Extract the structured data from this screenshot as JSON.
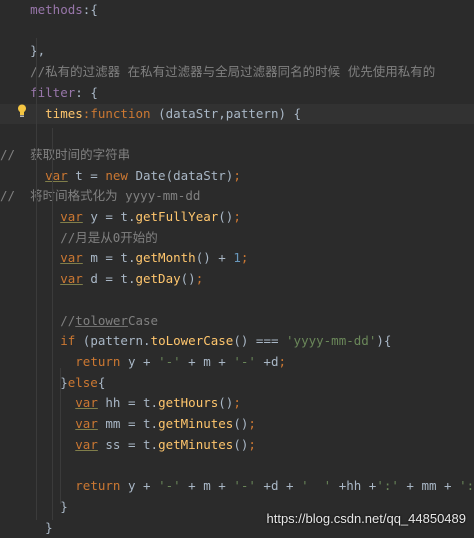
{
  "colors": {
    "background": "#2b2b2b",
    "keyword": "#cc7832",
    "property": "#9876aa",
    "function": "#ffc66d",
    "string": "#6a8759",
    "number": "#6897bb",
    "comment": "#808080",
    "text": "#a9b7c6"
  },
  "lines": [
    [
      {
        "t": "    "
      },
      {
        "t": "methods",
        "c": "prop"
      },
      {
        "t": ":{"
      }
    ],
    [
      {
        "t": ""
      }
    ],
    [
      {
        "t": "    },",
        "c": "plain"
      }
    ],
    [
      {
        "t": "    //私有的过滤器 在私有过滤器与全局过滤器同名的时候 优先使用私有的",
        "c": "cm"
      }
    ],
    [
      {
        "t": "    "
      },
      {
        "t": "filter",
        "c": "prop"
      },
      {
        "t": ": {"
      }
    ],
    [
      {
        "t": "      "
      },
      {
        "t": "times",
        "c": "fn"
      },
      {
        "t": ":",
        "c": "kw"
      },
      {
        "t": "function",
        "c": "kw"
      },
      {
        "t": " (dataStr,pattern) {"
      }
    ],
    [
      {
        "t": ""
      }
    ],
    [
      {
        "t": "//  获取时间的字符串",
        "c": "cm"
      }
    ],
    [
      {
        "t": "      "
      },
      {
        "t": "var",
        "c": "var"
      },
      {
        "t": " t = "
      },
      {
        "t": "new",
        "c": "kw"
      },
      {
        "t": " Date(dataStr)"
      },
      {
        "t": ";",
        "c": "kw"
      }
    ],
    [
      {
        "t": "//  将时间格式化为 yyyy-mm-dd",
        "c": "cm"
      }
    ],
    [
      {
        "t": "        "
      },
      {
        "t": "var",
        "c": "var"
      },
      {
        "t": " y = t."
      },
      {
        "t": "getFullYear",
        "c": "fn"
      },
      {
        "t": "()"
      },
      {
        "t": ";",
        "c": "kw"
      }
    ],
    [
      {
        "t": "        //月是从0开始的",
        "c": "cm"
      }
    ],
    [
      {
        "t": "        "
      },
      {
        "t": "var",
        "c": "var"
      },
      {
        "t": " m = t."
      },
      {
        "t": "getMonth",
        "c": "fn"
      },
      {
        "t": "() + "
      },
      {
        "t": "1",
        "c": "num"
      },
      {
        "t": ";",
        "c": "kw"
      }
    ],
    [
      {
        "t": "        "
      },
      {
        "t": "var",
        "c": "var"
      },
      {
        "t": " d = t."
      },
      {
        "t": "getDay",
        "c": "fn"
      },
      {
        "t": "()"
      },
      {
        "t": ";",
        "c": "kw"
      }
    ],
    [
      {
        "t": ""
      }
    ],
    [
      {
        "t": "        //",
        "c": "cm"
      },
      {
        "t": "tolower",
        "c": "cm",
        "u": true
      },
      {
        "t": "Case",
        "c": "cm"
      }
    ],
    [
      {
        "t": "        "
      },
      {
        "t": "if",
        "c": "kw"
      },
      {
        "t": " (pattern."
      },
      {
        "t": "toLowerCase",
        "c": "fn"
      },
      {
        "t": "() === "
      },
      {
        "t": "'yyyy-mm-dd'",
        "c": "str"
      },
      {
        "t": "){"
      }
    ],
    [
      {
        "t": "          "
      },
      {
        "t": "return",
        "c": "kw"
      },
      {
        "t": " y + "
      },
      {
        "t": "'-'",
        "c": "str"
      },
      {
        "t": " + m + "
      },
      {
        "t": "'-'",
        "c": "str"
      },
      {
        "t": " +d"
      },
      {
        "t": ";",
        "c": "kw"
      }
    ],
    [
      {
        "t": "        }"
      },
      {
        "t": "else",
        "c": "kw"
      },
      {
        "t": "{"
      }
    ],
    [
      {
        "t": "          "
      },
      {
        "t": "var",
        "c": "var"
      },
      {
        "t": " hh = t."
      },
      {
        "t": "getHours",
        "c": "fn"
      },
      {
        "t": "()"
      },
      {
        "t": ";",
        "c": "kw"
      }
    ],
    [
      {
        "t": "          "
      },
      {
        "t": "var",
        "c": "var"
      },
      {
        "t": " mm = t."
      },
      {
        "t": "getMinutes",
        "c": "fn"
      },
      {
        "t": "()"
      },
      {
        "t": ";",
        "c": "kw"
      }
    ],
    [
      {
        "t": "          "
      },
      {
        "t": "var",
        "c": "var"
      },
      {
        "t": " ss = t."
      },
      {
        "t": "getMinutes",
        "c": "fn"
      },
      {
        "t": "()"
      },
      {
        "t": ";",
        "c": "kw"
      }
    ],
    [
      {
        "t": ""
      }
    ],
    [
      {
        "t": "          "
      },
      {
        "t": "return",
        "c": "kw"
      },
      {
        "t": " y + "
      },
      {
        "t": "'-'",
        "c": "str"
      },
      {
        "t": " + m + "
      },
      {
        "t": "'-'",
        "c": "str"
      },
      {
        "t": " +d + "
      },
      {
        "t": "'  '",
        "c": "str"
      },
      {
        "t": " +hh +"
      },
      {
        "t": "':'",
        "c": "str"
      },
      {
        "t": " + mm + "
      },
      {
        "t": "':'",
        "c": "str"
      },
      {
        "t": " +"
      }
    ],
    [
      {
        "t": "        }"
      }
    ],
    [
      {
        "t": "      }"
      }
    ]
  ],
  "highlight_line": 5,
  "intention_icon": "lightbulb-icon",
  "watermark": "https://blog.csdn.net/qq_44850489"
}
